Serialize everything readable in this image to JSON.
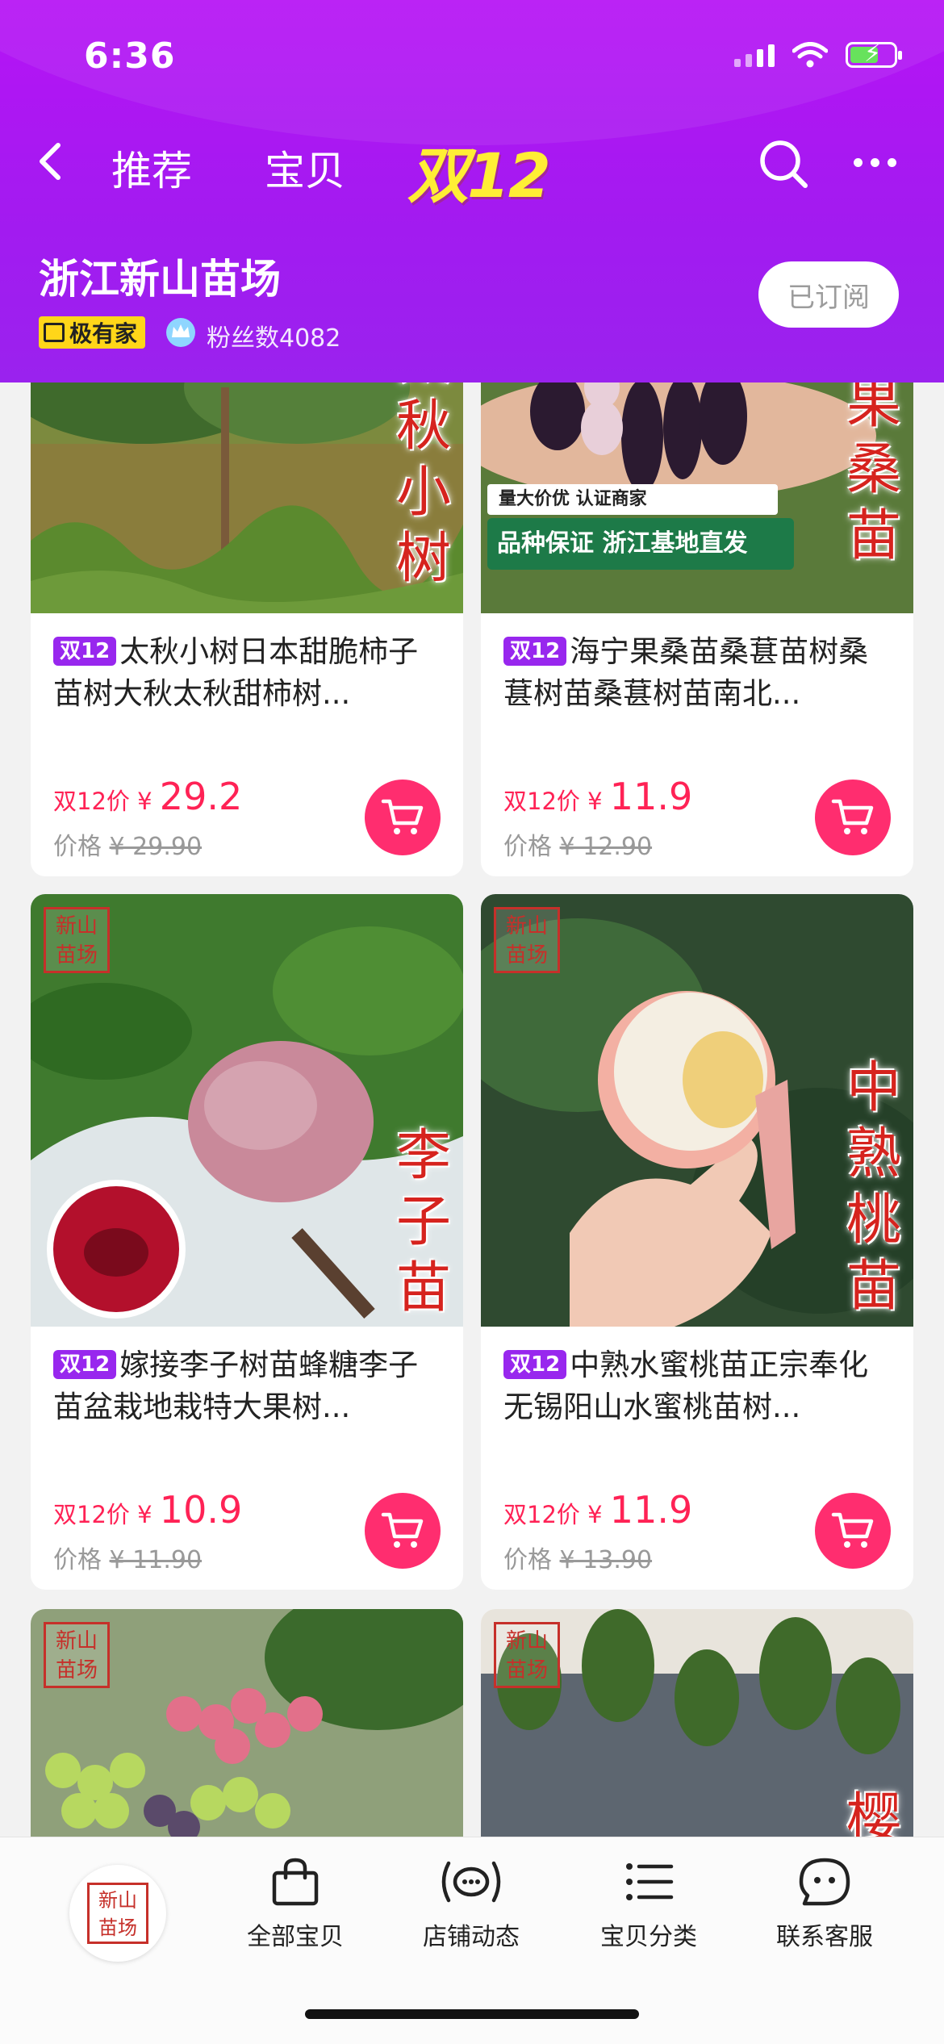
{
  "status_bar": {
    "time": "6:36"
  },
  "nav": {
    "tab_recommend": "推荐",
    "tab_items": "宝贝",
    "promo_logo": "双12"
  },
  "shop": {
    "name": "浙江新山苗场",
    "badge": "极有家",
    "fans": "粉丝数4082",
    "subscribe_label": "已订阅"
  },
  "products": [
    {
      "tag": "双12",
      "title": "太秋小树日本甜脆柿子苗树大秋太秋甜柿树...",
      "overlay": "太秋小树",
      "price_label": "双12价 ¥",
      "price": "29.2",
      "orig_label": "价格",
      "orig_price": "¥ 29.90"
    },
    {
      "tag": "双12",
      "title": "海宁果桑苗桑葚苗树桑葚树苗桑葚树苗南北...",
      "overlay": "果桑苗",
      "banner_top": "量大价优  认证商家",
      "banner_main": "品种保证  浙江基地直发",
      "price_label": "双12价 ¥",
      "price": "11.9",
      "orig_label": "价格",
      "orig_price": "¥ 12.90"
    },
    {
      "tag": "双12",
      "title": "嫁接李子树苗蜂糖李子苗盆栽地栽特大果树...",
      "overlay": "李子苗",
      "stamp": "新山苗场",
      "price_label": "双12价 ¥",
      "price": "10.9",
      "orig_label": "价格",
      "orig_price": "¥ 11.90"
    },
    {
      "tag": "双12",
      "title": "中熟水蜜桃苗正宗奉化无锡阳山水蜜桃苗树...",
      "overlay": "中熟桃苗",
      "stamp": "新山苗场",
      "price_label": "双12价 ¥",
      "price": "11.9",
      "orig_label": "价格",
      "orig_price": "¥ 13.90"
    },
    {
      "stamp": "新山苗场"
    },
    {
      "stamp": "新山苗场",
      "overlay": "樱"
    }
  ],
  "bottom_bar": {
    "home_logo": "新山苗场",
    "all_items": "全部宝贝",
    "shop_updates": "店铺动态",
    "categories": "宝贝分类",
    "customer_service": "联系客服"
  },
  "colors": {
    "header_purple": "#a21bf0",
    "promo_yellow": "#ffee35",
    "price_red": "#ff2255",
    "cart_pink": "#ff2d6f",
    "tag_purple": "#9827ee",
    "stamp_red": "#c6302a"
  }
}
